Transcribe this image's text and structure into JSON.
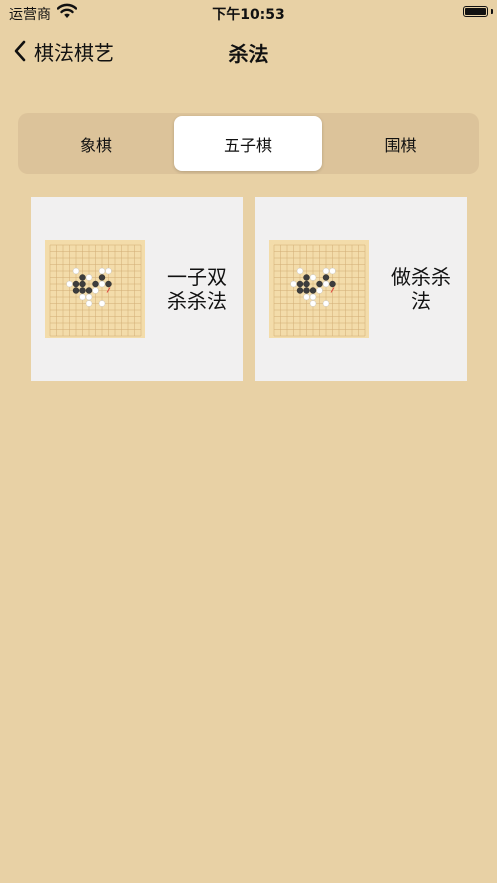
{
  "status_bar": {
    "carrier": "运营商",
    "time": "下午10:53"
  },
  "nav": {
    "back_label": "棋法棋艺",
    "title": "杀法"
  },
  "segments": [
    {
      "label": "象棋",
      "selected": false
    },
    {
      "label": "五子棋",
      "selected": true
    },
    {
      "label": "围棋",
      "selected": false
    }
  ],
  "cards": [
    {
      "title": "一子双杀杀法"
    },
    {
      "title": "做杀杀法"
    }
  ],
  "colors": {
    "background": "#e8d1a5",
    "segment_track": "#dcc39a",
    "card": "#f1f0f0",
    "board": "#f3dcaa",
    "grid_line": "#d2ad74",
    "last_move_marker": "#e0473f"
  }
}
